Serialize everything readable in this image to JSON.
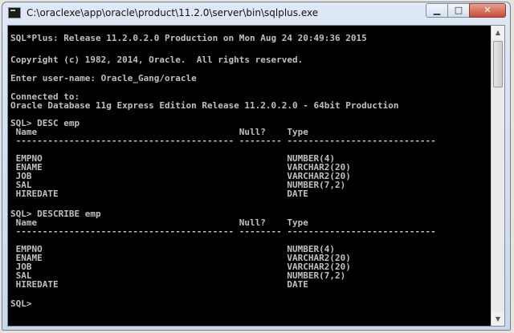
{
  "window": {
    "title": "C:\\oraclexe\\app\\oracle\\product\\11.2.0\\server\\bin\\sqlplus.exe",
    "minimize_glyph": "▁",
    "maximize_glyph": "□",
    "close_glyph": "✕"
  },
  "console": {
    "lines": [
      "SQL*Plus: Release 11.2.0.2.0 Production on Mon Aug 24 20:49:36 2015",
      "Copyright (c) 1982, 2014, Oracle.  All rights reserved.",
      "Enter user-name: Oracle_Gang/oracle",
      "Connected to:",
      "Oracle Database 11g Express Edition Release 11.2.0.2.0 - 64bit Production",
      "SQL> DESC emp",
      " Name                                      Null?    Type",
      " ----------------------------------------- -------- ----------------------------",
      " EMPNO                                              NUMBER(4)",
      " ENAME                                              VARCHAR2(20)",
      " JOB                                                VARCHAR2(20)",
      " SAL                                                NUMBER(7,2)",
      " HIREDATE                                           DATE",
      "SQL> DESCRIBE emp",
      " Name                                      Null?    Type",
      " ----------------------------------------- -------- ----------------------------",
      " EMPNO                                              NUMBER(4)",
      " ENAME                                              VARCHAR2(20)",
      " JOB                                                VARCHAR2(20)",
      " SAL                                                NUMBER(7,2)",
      " HIREDATE                                           DATE",
      "SQL>"
    ]
  },
  "scrollbar": {
    "up_glyph": "▲",
    "down_glyph": "▼"
  }
}
